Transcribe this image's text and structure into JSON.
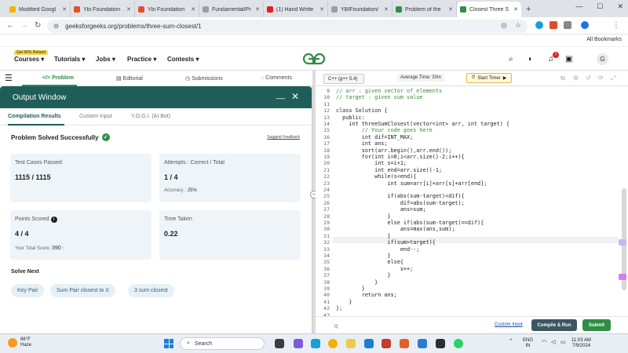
{
  "browser": {
    "tabs": [
      {
        "title": "Modified Googl",
        "color": "#f0b400"
      },
      {
        "title": "Ybi Foundation",
        "color": "#e2512b"
      },
      {
        "title": "Ybi Foundation",
        "color": "#e2512b"
      },
      {
        "title": "Fundamental/Pr",
        "color": "#9aa0a6"
      },
      {
        "title": "(1) Hand Writte",
        "color": "#e02020"
      },
      {
        "title": "YBIFoundation/",
        "color": "#9aa0a6"
      },
      {
        "title": "Problem of the",
        "color": "#2f8d46"
      },
      {
        "title": "Closest Three S",
        "color": "#2f8d46"
      }
    ],
    "new_tab": "+",
    "url": "geeksforgeeks.org/problems/three-sum-closest/1",
    "all_bookmarks": "All Bookmarks"
  },
  "gfg": {
    "refund_badge": "Get 90% Refund",
    "menus": [
      "Courses",
      "Tutorials",
      "Jobs",
      "Practice",
      "Contests"
    ],
    "notification_count": "7",
    "avatar": "G"
  },
  "problem_tabs": [
    "Problem",
    "Editorial",
    "Submissions",
    "Comments"
  ],
  "output": {
    "title": "Output Window",
    "tabs": [
      "Compilation Results",
      "Custom Input",
      "Y.O.G.I. (AI Bot)"
    ],
    "status": "Problem Solved Successfully",
    "suggest": "Suggest Feedback",
    "cards": {
      "tests_title": "Test Cases Passed",
      "tests_value": "1115 / 1115",
      "attempts_title": "Attempts : Correct / Total",
      "attempts_value": "1 / 4",
      "accuracy_label": "Accuracy :",
      "accuracy_value": "25%",
      "points_title": "Points Scored",
      "points_value": "4 / 4",
      "total_label": "Your Total Score:",
      "total_value": "390",
      "time_title": "Time Taken",
      "time_value": "0.22"
    },
    "solve_next": "Solve Next",
    "chips": [
      "Key Pair",
      "Sum Pair closest to X",
      "3 sum closest"
    ]
  },
  "editor": {
    "language": "C++ (g++ 5.4)",
    "avg_time": "Average Time: 30m",
    "timer": "Start Timer",
    "lines": [
      {
        "n": "9",
        "t": "// arr : given vector of elements",
        "c": "cm"
      },
      {
        "n": "10",
        "t": "// target : given sum value",
        "c": "cm"
      },
      {
        "n": "11",
        "t": ""
      },
      {
        "n": "12",
        "t": "class Solution {"
      },
      {
        "n": "13",
        "t": "  public:"
      },
      {
        "n": "14",
        "t": "    int threeSumClosest(vector<int> arr, int target) {"
      },
      {
        "n": "15",
        "t": "        // Your code goes here",
        "c": "cm"
      },
      {
        "n": "16",
        "t": "        int dif=INT_MAX;"
      },
      {
        "n": "17",
        "t": "        int ans;"
      },
      {
        "n": "18",
        "t": "        sort(arr.begin(),arr.end());"
      },
      {
        "n": "19",
        "t": "        for(int i=0;i<arr.size()-2;i++){"
      },
      {
        "n": "20",
        "t": "            int s=i+1;"
      },
      {
        "n": "21",
        "t": "            int end=arr.size()-1;"
      },
      {
        "n": "22",
        "t": "            while(s<end){"
      },
      {
        "n": "23",
        "t": "                int sum=arr[i]+arr[s]+arr[end];"
      },
      {
        "n": "24",
        "t": ""
      },
      {
        "n": "25",
        "t": "                if(abs(sum-target)<dif){"
      },
      {
        "n": "26",
        "t": "                    dif=abs(sum-target);"
      },
      {
        "n": "27",
        "t": "                    ans=sum;"
      },
      {
        "n": "28",
        "t": "                }"
      },
      {
        "n": "29",
        "t": "                else if(abs(sum-target)==dif){"
      },
      {
        "n": "30",
        "t": "                    ans=max(ans,sum);"
      },
      {
        "n": "31",
        "t": "                }"
      },
      {
        "n": "32",
        "t": "                if(sum>target){"
      },
      {
        "n": "33",
        "t": "                    end--;"
      },
      {
        "n": "34",
        "t": "                }"
      },
      {
        "n": "35",
        "t": "                else{"
      },
      {
        "n": "36",
        "t": "                    s++;"
      },
      {
        "n": "37",
        "t": "                }"
      },
      {
        "n": "38",
        "t": "            }"
      },
      {
        "n": "39",
        "t": "        }"
      },
      {
        "n": "40",
        "t": "        return ans;"
      },
      {
        "n": "41",
        "t": "    }"
      },
      {
        "n": "42",
        "t": "};"
      },
      {
        "n": "43",
        "t": ""
      }
    ],
    "custom_input": "Custom Input",
    "compile_run": "Compile & Run",
    "submit": "Submit"
  },
  "taskbar": {
    "temp": "86°F",
    "weather": "Haze",
    "search": "Search",
    "lang1": "ENG",
    "lang2": "IN",
    "time": "11:03 AM",
    "date": "7/9/2024"
  }
}
